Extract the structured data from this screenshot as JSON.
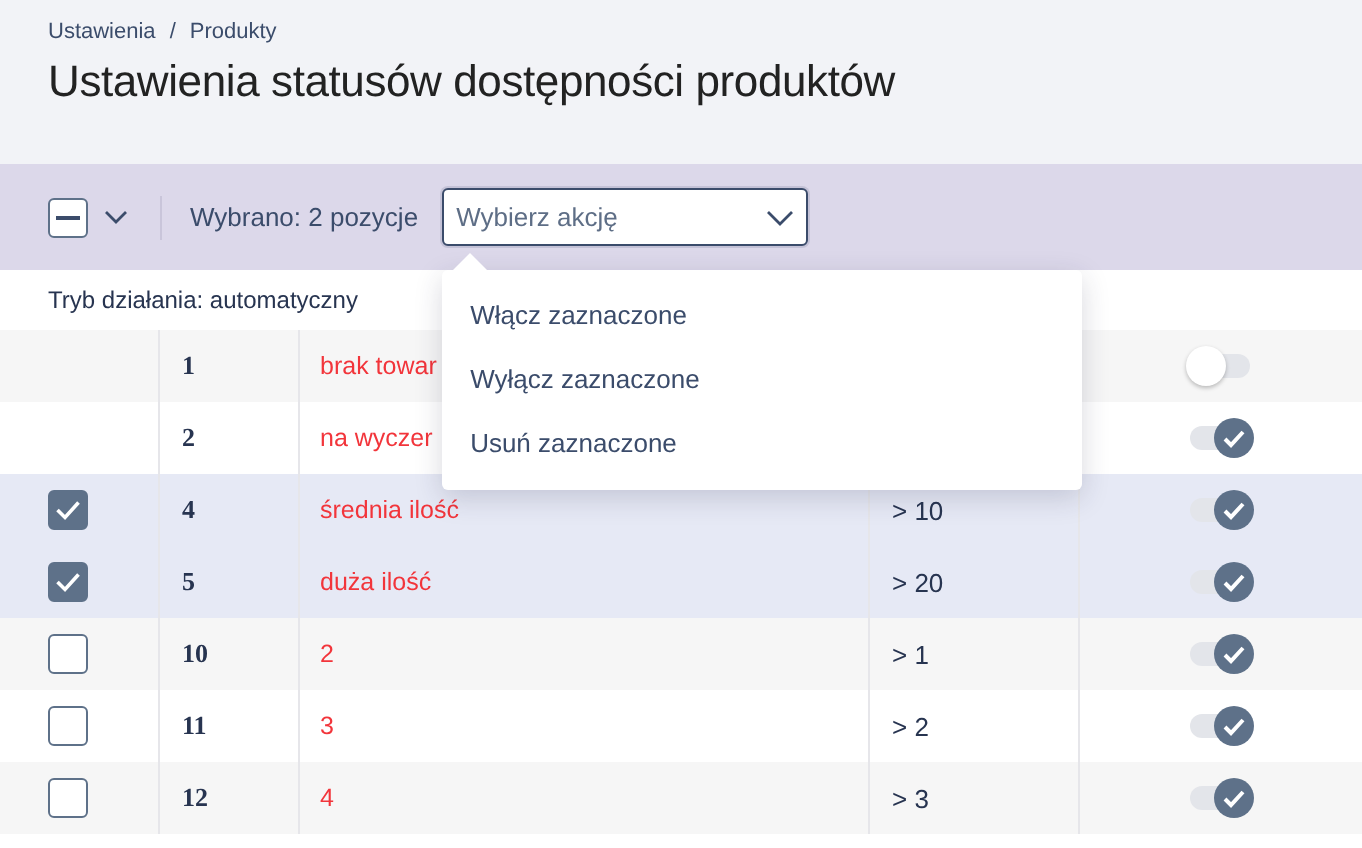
{
  "breadcrumb": [
    "Ustawienia",
    "Produkty"
  ],
  "breadcrumb_separator": "/",
  "title": "Ustawienia statusów dostępności produktów",
  "toolbar": {
    "bulk_checkbox": {
      "indeterminate": true
    },
    "selection_text": "Wybrano: 2 pozycje",
    "action_select": {
      "placeholder": "Wybierz akcję",
      "expanded": true
    }
  },
  "action_menu": [
    "Włącz zaznaczone",
    "Wyłącz zaznaczone",
    "Usuń zaznaczone"
  ],
  "mode_text": "Tryb działania: automatyczny",
  "rows": [
    {
      "kind": "fixed",
      "number": "1",
      "name": "brak towar",
      "on": false
    },
    {
      "kind": "fixed",
      "number": "2",
      "name": "na wyczer",
      "on": true
    },
    {
      "kind": "selectable",
      "checked": true,
      "number": "4",
      "name": "średnia ilość",
      "condition": "> 10",
      "on": true
    },
    {
      "kind": "selectable",
      "checked": true,
      "number": "5",
      "name": "duża ilość",
      "condition": "> 20",
      "on": true
    },
    {
      "kind": "selectable",
      "checked": false,
      "number": "10",
      "name": "2",
      "condition": "> 1",
      "on": true
    },
    {
      "kind": "selectable",
      "checked": false,
      "number": "11",
      "name": "3",
      "condition": "> 2",
      "on": true
    },
    {
      "kind": "selectable",
      "checked": false,
      "number": "12",
      "name": "4",
      "condition": "> 3",
      "on": true
    }
  ]
}
